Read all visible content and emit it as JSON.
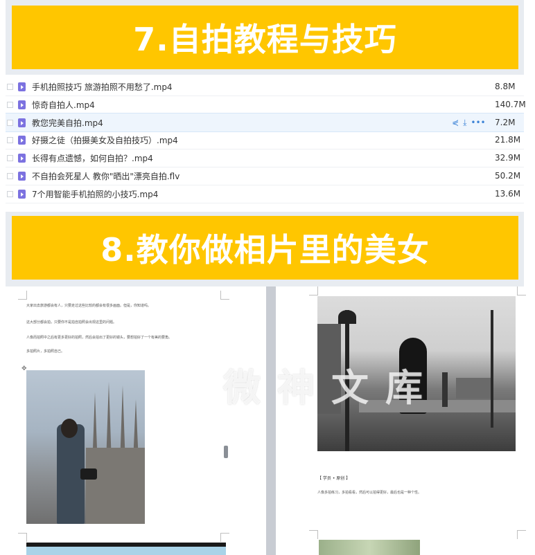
{
  "banners": {
    "section7": "7.自拍教程与技巧",
    "section8": "8.教你做相片里的美女"
  },
  "files": [
    {
      "name": "手机拍照技巧 旅游拍照不用愁了.mp4",
      "size": "8.8M"
    },
    {
      "name": "惊奇自拍人.mp4",
      "size": "140.7M"
    },
    {
      "name": "教您完美自拍.mp4",
      "size": "7.2M",
      "highlighted": true
    },
    {
      "name": "好摄之徒（拍摄美女及自拍技巧）.mp4",
      "size": "21.8M"
    },
    {
      "name": "长得有点遗憾，如何自拍？.mp4",
      "size": "32.9M"
    },
    {
      "name": "不自拍会死星人 教你\"晒出\"漂亮自拍.flv",
      "size": "50.2M"
    },
    {
      "name": "7个用智能手机拍照的小技巧.mp4",
      "size": "13.6M"
    }
  ],
  "row_actions": {
    "share_icon": "share-icon",
    "download_icon": "download-icon",
    "more_icon": "more-icon",
    "share": "⋞",
    "download": "⤓",
    "more": "•••"
  },
  "document": {
    "left_text": [
      "大家出去旅游都会有人，只要走过这些比较的都会有很多画面。但是，你知道吗。",
      "这大部分都会拍，只要你不是拍自拍照会出现这里的问题。",
      "人像而拍照中之后有更多更好的拍照，然后会拍出了更好的镜头，要想拍好了一个有美的要角。",
      "多拍照片，多拍照自己。"
    ],
    "right_caption_head": "【 学员 • 原创 】",
    "right_caption_body": "人像多拍练习，多拍看看，然后可以拍得更好，最后也是一种个性。",
    "watermark": "微神文库"
  },
  "colors": {
    "banner": "#ffc600",
    "panel": "#e8ecf1",
    "file_icon": "#7c72e0",
    "action": "#3b82d6"
  }
}
